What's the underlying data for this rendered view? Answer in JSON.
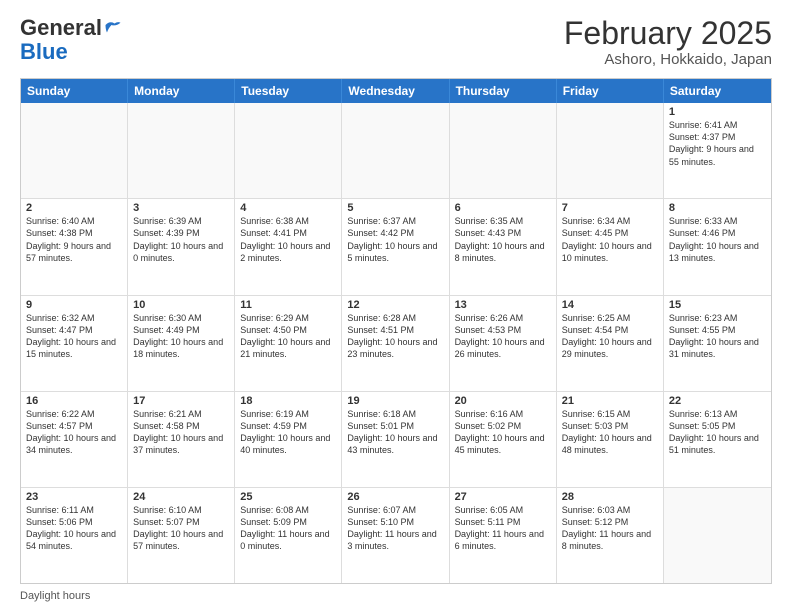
{
  "header": {
    "logo_line1": "General",
    "logo_line2": "Blue",
    "month_title": "February 2025",
    "location": "Ashoro, Hokkaido, Japan"
  },
  "weekdays": [
    "Sunday",
    "Monday",
    "Tuesday",
    "Wednesday",
    "Thursday",
    "Friday",
    "Saturday"
  ],
  "weeks": [
    [
      {
        "day": "",
        "info": ""
      },
      {
        "day": "",
        "info": ""
      },
      {
        "day": "",
        "info": ""
      },
      {
        "day": "",
        "info": ""
      },
      {
        "day": "",
        "info": ""
      },
      {
        "day": "",
        "info": ""
      },
      {
        "day": "1",
        "info": "Sunrise: 6:41 AM\nSunset: 4:37 PM\nDaylight: 9 hours and 55 minutes."
      }
    ],
    [
      {
        "day": "2",
        "info": "Sunrise: 6:40 AM\nSunset: 4:38 PM\nDaylight: 9 hours and 57 minutes."
      },
      {
        "day": "3",
        "info": "Sunrise: 6:39 AM\nSunset: 4:39 PM\nDaylight: 10 hours and 0 minutes."
      },
      {
        "day": "4",
        "info": "Sunrise: 6:38 AM\nSunset: 4:41 PM\nDaylight: 10 hours and 2 minutes."
      },
      {
        "day": "5",
        "info": "Sunrise: 6:37 AM\nSunset: 4:42 PM\nDaylight: 10 hours and 5 minutes."
      },
      {
        "day": "6",
        "info": "Sunrise: 6:35 AM\nSunset: 4:43 PM\nDaylight: 10 hours and 8 minutes."
      },
      {
        "day": "7",
        "info": "Sunrise: 6:34 AM\nSunset: 4:45 PM\nDaylight: 10 hours and 10 minutes."
      },
      {
        "day": "8",
        "info": "Sunrise: 6:33 AM\nSunset: 4:46 PM\nDaylight: 10 hours and 13 minutes."
      }
    ],
    [
      {
        "day": "9",
        "info": "Sunrise: 6:32 AM\nSunset: 4:47 PM\nDaylight: 10 hours and 15 minutes."
      },
      {
        "day": "10",
        "info": "Sunrise: 6:30 AM\nSunset: 4:49 PM\nDaylight: 10 hours and 18 minutes."
      },
      {
        "day": "11",
        "info": "Sunrise: 6:29 AM\nSunset: 4:50 PM\nDaylight: 10 hours and 21 minutes."
      },
      {
        "day": "12",
        "info": "Sunrise: 6:28 AM\nSunset: 4:51 PM\nDaylight: 10 hours and 23 minutes."
      },
      {
        "day": "13",
        "info": "Sunrise: 6:26 AM\nSunset: 4:53 PM\nDaylight: 10 hours and 26 minutes."
      },
      {
        "day": "14",
        "info": "Sunrise: 6:25 AM\nSunset: 4:54 PM\nDaylight: 10 hours and 29 minutes."
      },
      {
        "day": "15",
        "info": "Sunrise: 6:23 AM\nSunset: 4:55 PM\nDaylight: 10 hours and 31 minutes."
      }
    ],
    [
      {
        "day": "16",
        "info": "Sunrise: 6:22 AM\nSunset: 4:57 PM\nDaylight: 10 hours and 34 minutes."
      },
      {
        "day": "17",
        "info": "Sunrise: 6:21 AM\nSunset: 4:58 PM\nDaylight: 10 hours and 37 minutes."
      },
      {
        "day": "18",
        "info": "Sunrise: 6:19 AM\nSunset: 4:59 PM\nDaylight: 10 hours and 40 minutes."
      },
      {
        "day": "19",
        "info": "Sunrise: 6:18 AM\nSunset: 5:01 PM\nDaylight: 10 hours and 43 minutes."
      },
      {
        "day": "20",
        "info": "Sunrise: 6:16 AM\nSunset: 5:02 PM\nDaylight: 10 hours and 45 minutes."
      },
      {
        "day": "21",
        "info": "Sunrise: 6:15 AM\nSunset: 5:03 PM\nDaylight: 10 hours and 48 minutes."
      },
      {
        "day": "22",
        "info": "Sunrise: 6:13 AM\nSunset: 5:05 PM\nDaylight: 10 hours and 51 minutes."
      }
    ],
    [
      {
        "day": "23",
        "info": "Sunrise: 6:11 AM\nSunset: 5:06 PM\nDaylight: 10 hours and 54 minutes."
      },
      {
        "day": "24",
        "info": "Sunrise: 6:10 AM\nSunset: 5:07 PM\nDaylight: 10 hours and 57 minutes."
      },
      {
        "day": "25",
        "info": "Sunrise: 6:08 AM\nSunset: 5:09 PM\nDaylight: 11 hours and 0 minutes."
      },
      {
        "day": "26",
        "info": "Sunrise: 6:07 AM\nSunset: 5:10 PM\nDaylight: 11 hours and 3 minutes."
      },
      {
        "day": "27",
        "info": "Sunrise: 6:05 AM\nSunset: 5:11 PM\nDaylight: 11 hours and 6 minutes."
      },
      {
        "day": "28",
        "info": "Sunrise: 6:03 AM\nSunset: 5:12 PM\nDaylight: 11 hours and 8 minutes."
      },
      {
        "day": "",
        "info": ""
      }
    ]
  ],
  "footer": {
    "label": "Daylight hours"
  }
}
